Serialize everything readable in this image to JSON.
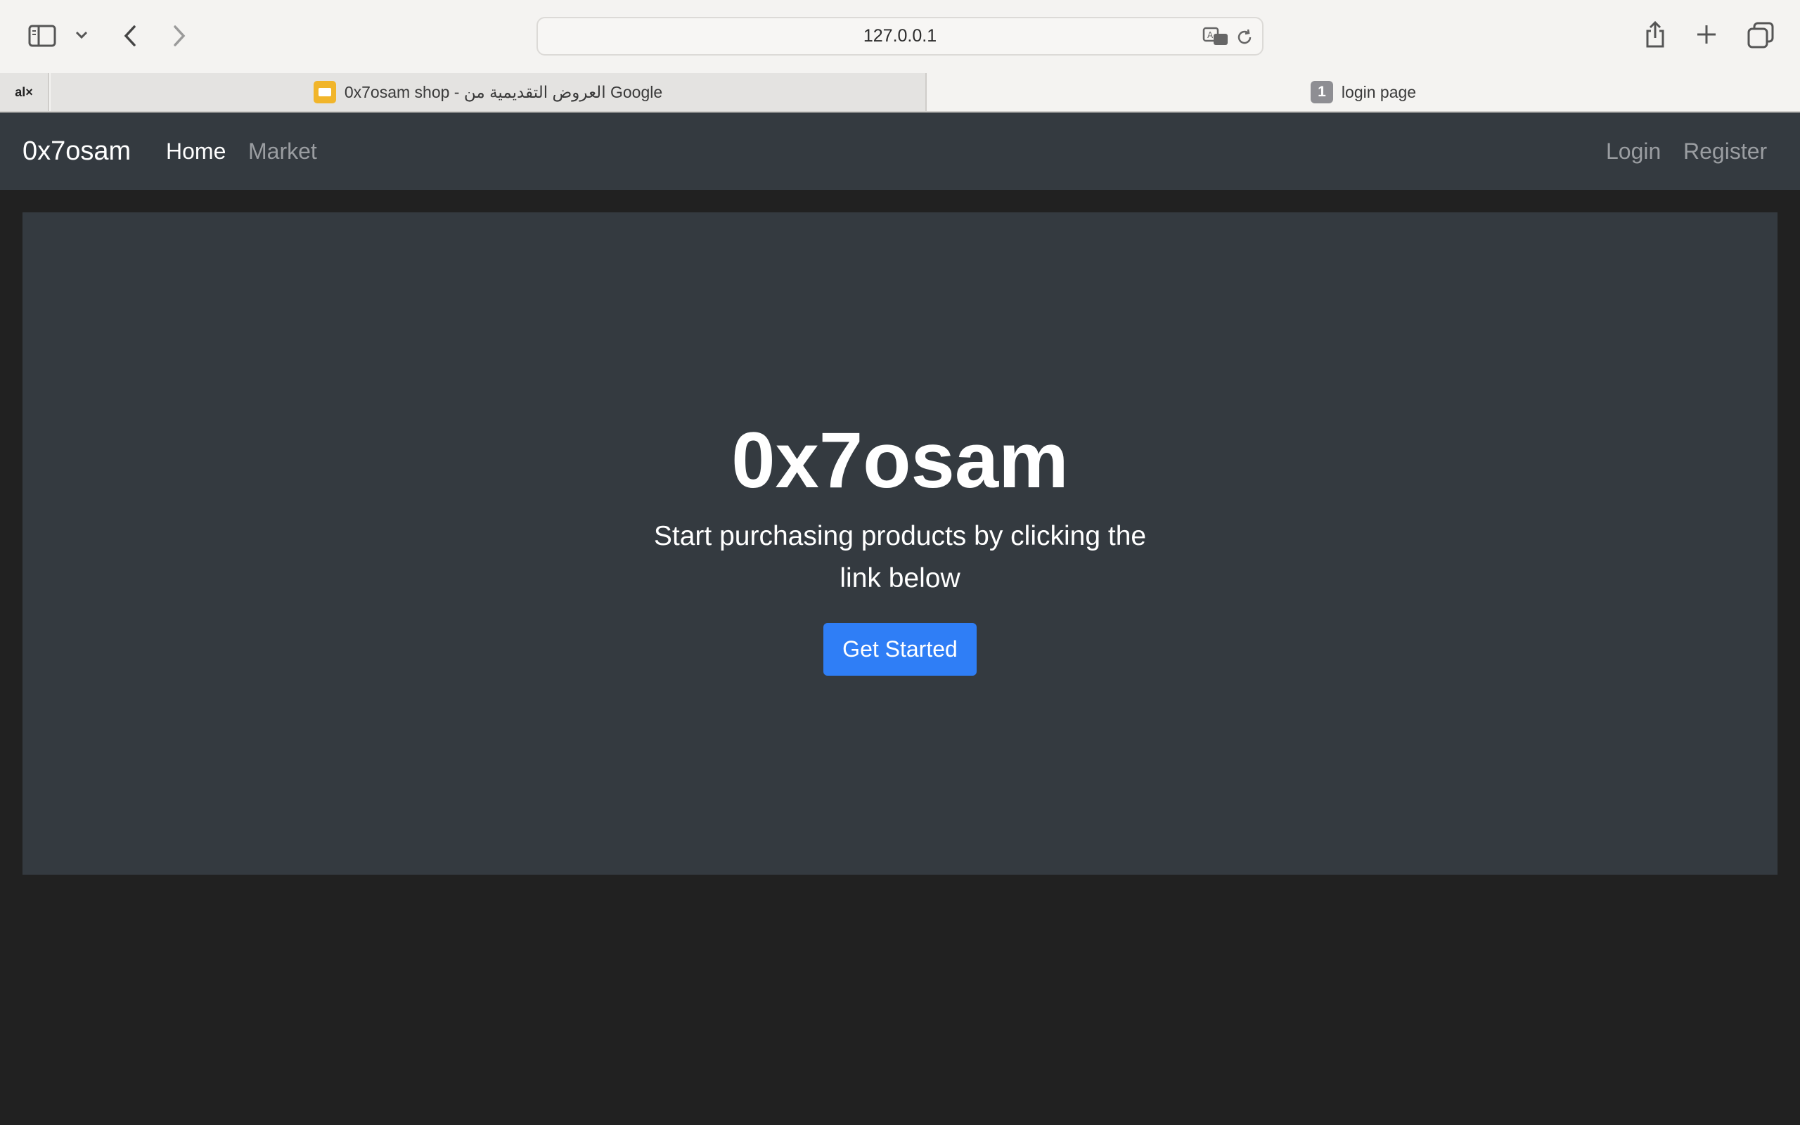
{
  "browser": {
    "url": "127.0.0.1",
    "pinned_tab_label": "al×",
    "tabs": [
      {
        "title": "0x7osam shop - العروض التقديمية من Google",
        "active": true
      },
      {
        "title": "login page",
        "badge": "1",
        "active": false
      }
    ]
  },
  "site": {
    "brand": "0x7osam",
    "nav_left": [
      {
        "label": "Home",
        "active": true
      },
      {
        "label": "Market",
        "active": false
      }
    ],
    "nav_right": [
      {
        "label": "Login"
      },
      {
        "label": "Register"
      }
    ]
  },
  "hero": {
    "title": "0x7osam",
    "subtitle": "Start purchasing products by clicking the link below",
    "cta_label": "Get Started"
  },
  "colors": {
    "page_bg": "#212121",
    "navbar_bg": "#343a40",
    "jumbotron_bg": "#343a40",
    "primary": "#2f7ef6"
  }
}
